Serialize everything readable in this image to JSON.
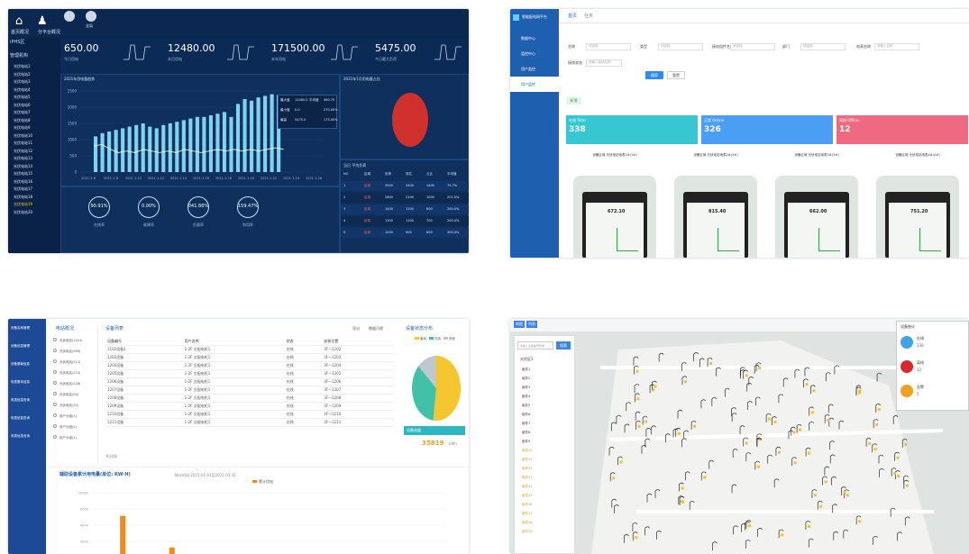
{
  "c1": {
    "top_tabs": [
      "首页概况",
      "分平台概况"
    ],
    "buttons": [
      "全局"
    ],
    "sidebar_header": "IPHS区",
    "sidebar_title": "管理机构",
    "tree_items": [
      "光伏电站1",
      "光伏电站2",
      "光伏电站3",
      "光伏电站4",
      "光伏电站5",
      "光伏电站6",
      "光伏电站7",
      "光伏电站8",
      "光伏电站9",
      "光伏电站10",
      "光伏电站11",
      "光伏电站12",
      "光伏电站13",
      "光伏电站14",
      "光伏电站15",
      "光伏电站16",
      "光伏电站17",
      "光伏电站18",
      "光伏电站19",
      "光伏电站20"
    ],
    "tree_selected": "光伏电站19",
    "kpis": [
      {
        "value": "650.00",
        "label": "今日用电"
      },
      {
        "value": "12480.00",
        "label": "本月用电"
      },
      {
        "value": "171500.00",
        "label": "本年用电"
      },
      {
        "value": "5475.00",
        "label": "今日最大负荷"
      }
    ],
    "chart_title": "2021年用电量趋势",
    "chart_data": {
      "type": "bar",
      "x_ticks": [
        "2021-1-6",
        "2021-1-8",
        "2021-1-10",
        "2021-1-12",
        "2021-1-14",
        "2021-1-16",
        "2021-1-18",
        "2021-1-20",
        "2021-1-22",
        "2021-1-24",
        "2021-1-26"
      ],
      "y_ticks": [
        "0",
        "500",
        "1000",
        "1500",
        "2000",
        "2500"
      ],
      "ylim": [
        0,
        2500
      ],
      "bars": [
        1100,
        1200,
        1250,
        1300,
        1350,
        1400,
        1450,
        1500,
        1400,
        1350,
        1450,
        1500,
        1550,
        1600,
        1650,
        1700,
        1700,
        1750,
        1800,
        1850,
        1700,
        2100,
        2250,
        2200,
        2300,
        2350,
        2400,
        2380
      ],
      "line": [
        800,
        850,
        700,
        600,
        650,
        600,
        700,
        650,
        600,
        650,
        600,
        700,
        650,
        600,
        650,
        700,
        650,
        700,
        650,
        700,
        650,
        700,
        750,
        700
      ]
    },
    "legend_rows": [
      [
        "最大值",
        "12480.0",
        "平均值",
        "460.79"
      ],
      [
        "最小值",
        "0.0",
        "",
        "270.00%"
      ],
      [
        "最高",
        "5475.0",
        "",
        "175.00%"
      ]
    ],
    "gauges": [
      {
        "value": "90.91%",
        "label": "在线率"
      },
      {
        "value": "0.00%",
        "label": "故障率"
      },
      {
        "value": "041.86%",
        "label": "负载率"
      },
      {
        "value": "159.47%",
        "label": "利用率"
      }
    ],
    "pie_title": "2021年1月用电量占比",
    "table_title": "当日 平均负荷",
    "table_headers": [
      "NO",
      "区域",
      "负荷",
      "排名",
      "占比",
      "平均值"
    ],
    "table_rows": [
      [
        "1",
        "区域",
        "3000",
        "3400",
        "1400",
        "75.7%"
      ],
      [
        "2",
        "区域",
        "2600",
        "2100",
        "1000",
        "201.0%"
      ],
      [
        "3",
        "区域",
        "1400",
        "1200",
        "800",
        "200.0%"
      ],
      [
        "4",
        "区域",
        "1300",
        "1100",
        "700",
        "200.0%"
      ],
      [
        "5",
        "区域",
        "1200",
        "900",
        "600",
        "200.0%"
      ]
    ]
  },
  "c2": {
    "logo": "智能配电网平台",
    "tabs": [
      "首页",
      "任务"
    ],
    "nav": [
      "数据中心",
      "监控中心",
      "用户监控",
      "用户监控",
      "",
      "",
      "",
      "",
      "",
      "",
      "",
      "",
      "",
      ""
    ],
    "filter_labels": [
      "名称",
      "类型",
      "接电组件名",
      "部门",
      "电表名称",
      "接线状态"
    ],
    "placeholders": [
      "请选择",
      "请选择",
      "请选择",
      "请选择",
      "请输入名称",
      "请输入接线名称"
    ],
    "btn_search": "搜索",
    "btn_reset": "重置",
    "btn_add": "新增",
    "stats": [
      {
        "label": "在线 Total",
        "value": "338",
        "color": "#37c7d3"
      },
      {
        "label": "正常 Online",
        "value": "326",
        "color": "#4a9ff5"
      },
      {
        "label": "离线 Offline",
        "value": "12",
        "color": "#ef6a80"
      }
    ],
    "device_titles": [
      "设备区域 光伏电站电表1#(1#)",
      "设备区域 光伏电站电表2#(2#)",
      "设备区域 光伏电站电表3#(3#)",
      "设备区域 光伏电站电表4#(4#)"
    ],
    "device_values": [
      "672.10",
      "815.40",
      "662.00",
      "751.20"
    ]
  },
  "c3": {
    "left_menu": [
      "设备名称管理",
      "设备信息管理",
      "设备基础信息",
      "电表基本信息",
      "电表信息查询",
      "电表信息查询",
      "电表信息查询"
    ],
    "site_panel_title": "电站概况",
    "sites": [
      "光伏电站(1024)",
      "光伏电站(999)",
      "光伏电站(512)",
      "光伏电站(210)",
      "光伏电站(128)",
      "光伏电站(64)",
      "光伏电站(32)",
      "用户分组(3)",
      "用户分组(2)",
      "用户分组(1)"
    ],
    "list_title": "设备列表",
    "btn_export": "导出",
    "btn_more": "数据可视",
    "table_headers": [
      "设备编号",
      "用户名称",
      "状态",
      "安装位置"
    ],
    "table_rows": [
      [
        "1102设备1",
        "1-2F 交配电柜1",
        "在线",
        "3F一1102"
      ],
      [
        "1203设备",
        "1-2F 交配电柜1",
        "在线",
        "3F一1203"
      ],
      [
        "1204设备",
        "1-2F 交配电柜1",
        "在线",
        "3F一1204"
      ],
      [
        "1205设备",
        "1-2F 交配电柜1",
        "在线",
        "3F一1205"
      ],
      [
        "1206设备",
        "1-2F 交配电柜1",
        "在线",
        "3F一1206"
      ],
      [
        "1207设备",
        "1-2F 交配电柜1",
        "在线",
        "3F一1207"
      ],
      [
        "1208设备",
        "1-2F 交配电柜1",
        "在线",
        "3F一1208"
      ],
      [
        "1209设备",
        "1-2F 交配电柜1",
        "在线",
        "3F一1209"
      ],
      [
        "1210设备",
        "1-2F 交配电柜1",
        "在线",
        "3F一1210"
      ],
      [
        "1211设备",
        "1-2F 交配电柜1",
        "在线",
        "3F一1211"
      ]
    ],
    "pager": "共10条",
    "pie_title": "设备状态分布",
    "pie_legend": [
      "离线",
      "在线",
      "其他"
    ],
    "pie_data": [
      {
        "name": "离线",
        "value": 52,
        "color": "#f5c62f"
      },
      {
        "name": "在线",
        "value": 35,
        "color": "#43c1a8"
      },
      {
        "name": "其他",
        "value": 13,
        "color": "#bfc8cf"
      }
    ],
    "total_label": "设备电量",
    "total_value": "35819",
    "total_unit": "kWh",
    "bottom_title": "辅助设备累计用电量(单位: KW·H)",
    "bottom_sub": "统计时间 2021-01-01至2021-03-31",
    "bottom_legend": "累计用电",
    "y_ticks": [
      "10000",
      "8000",
      "6000",
      "4000"
    ],
    "bars": [
      {
        "h": 0.62,
        "x": 0.08
      },
      {
        "h": 0.12,
        "x": 0.22
      }
    ]
  },
  "c4": {
    "tabs": [
      "地图",
      "列表"
    ],
    "search_placeholder": "请输入设备编号查询",
    "search_btn": "搜索",
    "tree_root": "光伏区1",
    "tree_items": [
      "组件1",
      "组件2",
      "组件3",
      "组件4",
      "组件5",
      "组件6",
      "组件7",
      "组件8",
      "组件9",
      "组件10",
      "组件11",
      "组件12",
      "组件13",
      "组件14",
      "组件15",
      "组件16",
      "组件17",
      "组件18",
      "组件19"
    ],
    "legend_title": "设备统计",
    "legend_items": [
      {
        "label": "在线",
        "color": "#3da4e6",
        "val": "338"
      },
      {
        "label": "离线",
        "color": "#d9272e",
        "val": "12"
      },
      {
        "label": "告警",
        "color": "#f0a020",
        "val": "5"
      }
    ]
  }
}
